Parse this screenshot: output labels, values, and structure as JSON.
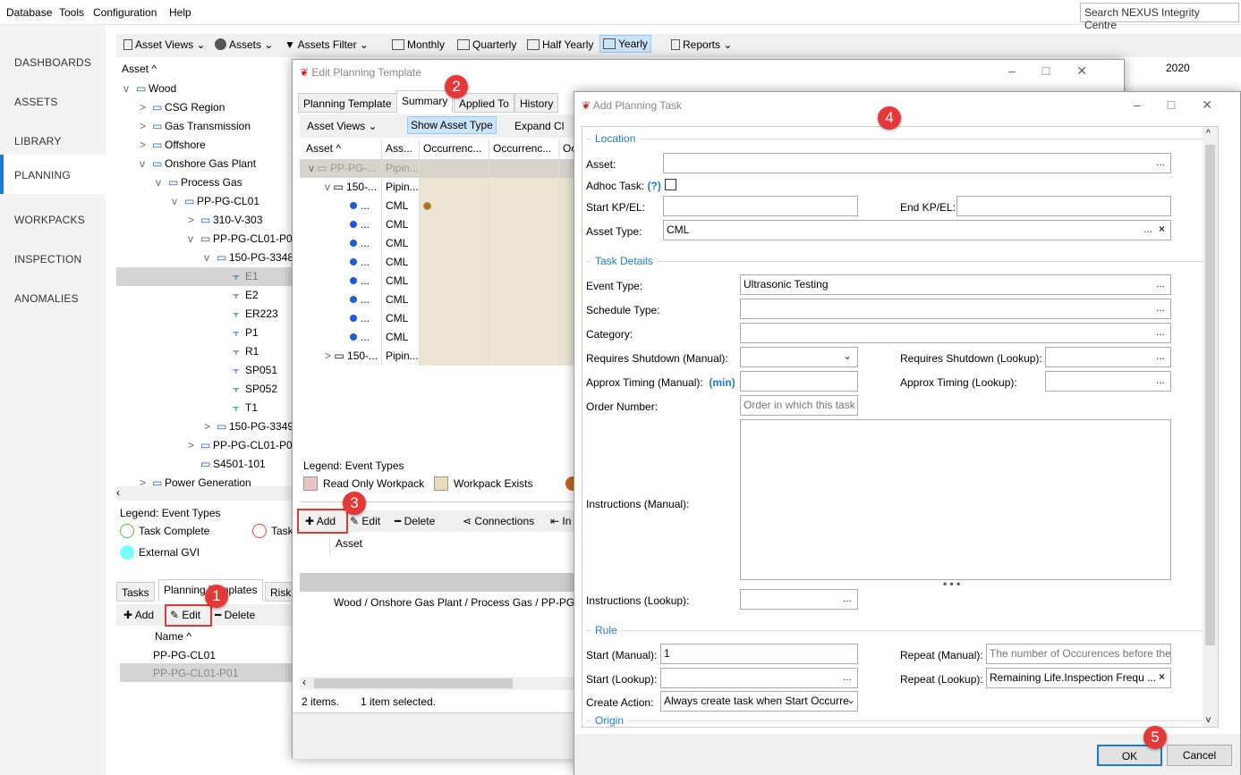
{
  "menu": [
    "Database",
    "Tools",
    "Configuration",
    "Help"
  ],
  "search_placeholder": "Search NEXUS Integrity Centre",
  "nav": [
    "DASHBOARDS",
    "ASSETS",
    "LIBRARY",
    "PLANNING",
    "WORKPACKS",
    "INSPECTION",
    "ANOMALIES"
  ],
  "nav_selected": "PLANNING",
  "toolbar": {
    "asset_views": "Asset Views",
    "assets": "Assets",
    "assets_filter": "Assets Filter",
    "monthly": "Monthly",
    "quarterly": "Quarterly",
    "half_yearly": "Half Yearly",
    "yearly": "Yearly",
    "reports": "Reports"
  },
  "tree_header": "Asset",
  "year": "2020",
  "tree": [
    {
      "label": "Wood",
      "lvl": 0,
      "exp": "v"
    },
    {
      "label": "CSG Region",
      "lvl": 1,
      "exp": ">"
    },
    {
      "label": "Gas Transmission",
      "lvl": 1,
      "exp": ">"
    },
    {
      "label": "Offshore",
      "lvl": 1,
      "exp": ">"
    },
    {
      "label": "Onshore Gas Plant",
      "lvl": 1,
      "exp": "v"
    },
    {
      "label": "Process Gas",
      "lvl": 2,
      "exp": "v"
    },
    {
      "label": "PP-PG-CL01",
      "lvl": 3,
      "exp": "v"
    },
    {
      "label": "310-V-303",
      "lvl": 4,
      "exp": ">"
    },
    {
      "label": "PP-PG-CL01-P0",
      "lvl": 4,
      "exp": "v"
    },
    {
      "label": "150-PG-3348",
      "lvl": 5,
      "exp": "v"
    },
    {
      "label": "E1",
      "lvl": 6,
      "exp": "",
      "sel": true
    },
    {
      "label": "E2",
      "lvl": 6,
      "exp": ""
    },
    {
      "label": "ER223",
      "lvl": 6,
      "exp": ""
    },
    {
      "label": "P1",
      "lvl": 6,
      "exp": ""
    },
    {
      "label": "R1",
      "lvl": 6,
      "exp": ""
    },
    {
      "label": "SP051",
      "lvl": 6,
      "exp": ""
    },
    {
      "label": "SP052",
      "lvl": 6,
      "exp": ""
    },
    {
      "label": "T1",
      "lvl": 6,
      "exp": ""
    },
    {
      "label": "150-PG-3349",
      "lvl": 5,
      "exp": ">"
    },
    {
      "label": "PP-PG-CL01-P0",
      "lvl": 4,
      "exp": ">"
    },
    {
      "label": "S4501-101",
      "lvl": 4,
      "exp": ""
    },
    {
      "label": "Power Generation",
      "lvl": 1,
      "exp": ">"
    }
  ],
  "legend": {
    "title": "Legend: Event Types",
    "items": [
      "Task Complete",
      "Task",
      "External GVI"
    ]
  },
  "bottom": {
    "tabs": [
      "Tasks",
      "Planning Templates",
      "Risk"
    ],
    "add": "Add",
    "edit": "Edit",
    "delete": "Delete",
    "col": "Name",
    "rows": [
      "PP-PG-CL01",
      "PP-PG-CL01-P01"
    ]
  },
  "edit_dialog": {
    "title": "Edit Planning Template",
    "tabs": [
      "Planning Template",
      "Summary",
      "Applied To",
      "History"
    ],
    "asset_views": "Asset Views",
    "show_asset_type": "Show Asset Type",
    "expand": "Expand Cl",
    "cols": [
      "Asset",
      "Ass...",
      "Occurrenc...",
      "Occurrenc...",
      "Oc"
    ],
    "rows": [
      {
        "a": "PP-PG-...",
        "t": "Pipin...",
        "lvl": 0,
        "exp": "v"
      },
      {
        "a": "150-...",
        "t": "Pipin...",
        "lvl": 1,
        "exp": "v"
      },
      {
        "a": "...",
        "t": "CML",
        "lvl": 2,
        "dot": true
      },
      {
        "a": "...",
        "t": "CML",
        "lvl": 2
      },
      {
        "a": "...",
        "t": "CML",
        "lvl": 2
      },
      {
        "a": "...",
        "t": "CML",
        "lvl": 2
      },
      {
        "a": "...",
        "t": "CML",
        "lvl": 2
      },
      {
        "a": "...",
        "t": "CML",
        "lvl": 2
      },
      {
        "a": "...",
        "t": "CML",
        "lvl": 2
      },
      {
        "a": "...",
        "t": "CML",
        "lvl": 2
      },
      {
        "a": "150-...",
        "t": "Pipin...",
        "lvl": 1,
        "exp": ">"
      }
    ],
    "legend_title": "Legend: Event Types",
    "legend": [
      "Read Only Workpack",
      "Workpack Exists"
    ],
    "legend_colors": [
      "#e8c4c4",
      "#e8dcbc"
    ],
    "add": "Add",
    "edit": "Edit",
    "delete": "Delete",
    "connections": "Connections",
    "in": "In",
    "asset_col": "Asset",
    "path": "Wood / Onshore Gas Plant / Process Gas / PP-PG-C",
    "status_items": "2 items.",
    "status_sel": "1 item selected."
  },
  "add_dialog": {
    "title": "Add Planning Task",
    "location": "Location",
    "asset": "Asset:",
    "adhoc": "Adhoc Task:",
    "adhoc_help": "(?)",
    "start_kp": "Start KP/EL:",
    "end_kp": "End KP/EL:",
    "asset_type": "Asset Type:",
    "asset_type_value": "CML",
    "task_details": "Task Details",
    "event_type": "Event Type:",
    "event_type_value": "Ultrasonic Testing",
    "schedule_type": "Schedule Type:",
    "category": "Category:",
    "req_shut_manual": "Requires Shutdown (Manual):",
    "req_shut_lookup": "Requires Shutdown (Lookup):",
    "approx_manual": "Approx Timing (Manual):",
    "approx_unit": "(min)",
    "approx_lookup": "Approx Timing (Lookup):",
    "order_number": "Order Number:",
    "order_placeholder": "Order in which this task",
    "instr_manual": "Instructions (Manual):",
    "instr_lookup": "Instructions (Lookup):",
    "rule": "Rule",
    "start_manual": "Start (Manual):",
    "start_manual_value": "1",
    "start_lookup": "Start (Lookup):",
    "create_action": "Create Action:",
    "create_action_value": "Always create task when Start Occurre",
    "repeat_manual": "Repeat (Manual):",
    "repeat_manual_placeholder": "The number of Occurences before the",
    "repeat_lookup": "Repeat (Lookup):",
    "repeat_lookup_value": "Remaining Life.Inspection Frequ ...",
    "origin": "Origin",
    "ok": "OK",
    "cancel": "Cancel"
  },
  "badges": [
    "1",
    "2",
    "3",
    "4",
    "5"
  ],
  "accent": "#1e7bd4",
  "badge_color": "#e53838"
}
